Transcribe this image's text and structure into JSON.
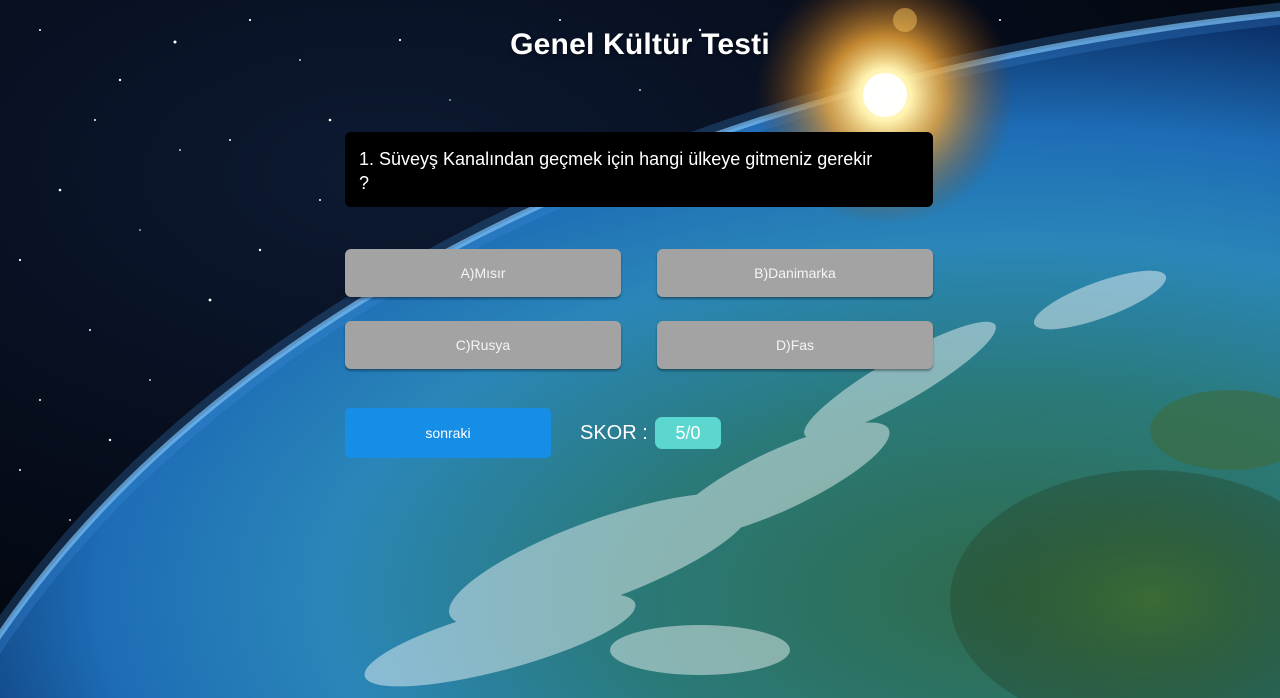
{
  "page": {
    "title": "Genel Kültür Testi"
  },
  "question": {
    "text": "1. Süveyş Kanalından geçmek için hangi ülkeye gitmeniz gerekir ?"
  },
  "answers": [
    {
      "label": "A)Mısır"
    },
    {
      "label": "B)Danimarka"
    },
    {
      "label": "C)Rusya"
    },
    {
      "label": "D)Fas"
    }
  ],
  "controls": {
    "next_label": "sonraki"
  },
  "score": {
    "label": "SKOR :",
    "value": "5/0"
  },
  "colors": {
    "question_bg": "#000000",
    "answer_bg": "#a3a3a3",
    "next_bg": "#168ee6",
    "score_bg": "#5bd7cf",
    "text": "#ffffff"
  }
}
